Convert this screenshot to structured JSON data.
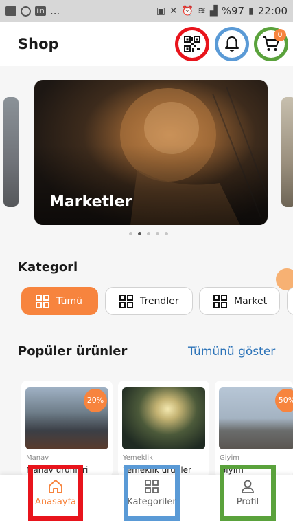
{
  "status_bar": {
    "left_icons": [
      "video-icon",
      "instagram-icon",
      "linkedin-icon"
    ],
    "left_more": "...",
    "battery": "%97",
    "time": "22:00",
    "right_icons": [
      "cast-icon",
      "mute-icon",
      "alarm-icon",
      "wifi-icon",
      "signal-icon",
      "battery-icon"
    ]
  },
  "header": {
    "title": "Shop",
    "actions": [
      {
        "name": "qr-code-icon",
        "highlight": "#e8141c"
      },
      {
        "name": "bell-icon",
        "highlight": "#5a9ad6"
      },
      {
        "name": "cart-icon",
        "highlight": "#5aa23c"
      }
    ],
    "cart_count": "0"
  },
  "carousel": {
    "banner_title": "Marketler",
    "slide_count": 5,
    "active_slide": 2
  },
  "categories": {
    "title": "Kategori",
    "chips": [
      {
        "label": "Tümü",
        "active": true
      },
      {
        "label": "Trendler",
        "active": false
      },
      {
        "label": "Market",
        "active": false
      }
    ]
  },
  "popular": {
    "title": "Popüler ürünler",
    "see_all": "Tümünü göster",
    "items": [
      {
        "category": "Manav",
        "name": "Manav ürünleri",
        "badge": "20%"
      },
      {
        "category": "Yemeklik",
        "name": "Yemeklik ürünler",
        "badge": ""
      },
      {
        "category": "Giyim",
        "name": "Giyim",
        "badge": "50%"
      }
    ]
  },
  "bottom_nav": {
    "items": [
      {
        "label": "Anasayfa",
        "icon": "home-icon",
        "active": true
      },
      {
        "label": "Kategoriler",
        "icon": "grid-icon",
        "active": false
      },
      {
        "label": "Profil",
        "icon": "user-icon",
        "active": false
      }
    ]
  },
  "colors": {
    "accent": "#f7843e",
    "link": "#2c73b8",
    "highlight_red": "#e8141c",
    "highlight_blue": "#5a9ad6",
    "highlight_green": "#5aa23c"
  }
}
